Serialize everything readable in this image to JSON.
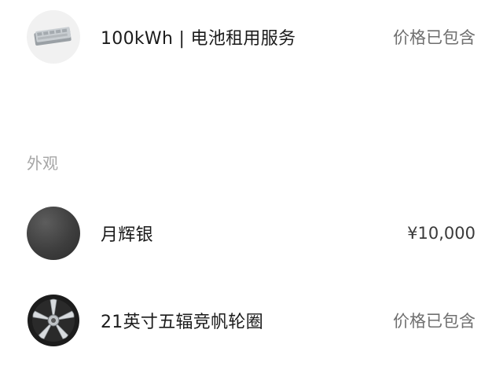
{
  "battery": {
    "title": "100kWh | 电池租用服务",
    "price": "价格已包含",
    "icon": "battery-pack-icon"
  },
  "exterior_section": {
    "label": "外观"
  },
  "color_option": {
    "title": "月辉银",
    "price": "¥10,000",
    "swatch_color": "#3e3e3e"
  },
  "wheel_option": {
    "title": "21英寸五辐竞帆轮圈",
    "price": "价格已包含",
    "icon": "wheel-rim-icon"
  }
}
